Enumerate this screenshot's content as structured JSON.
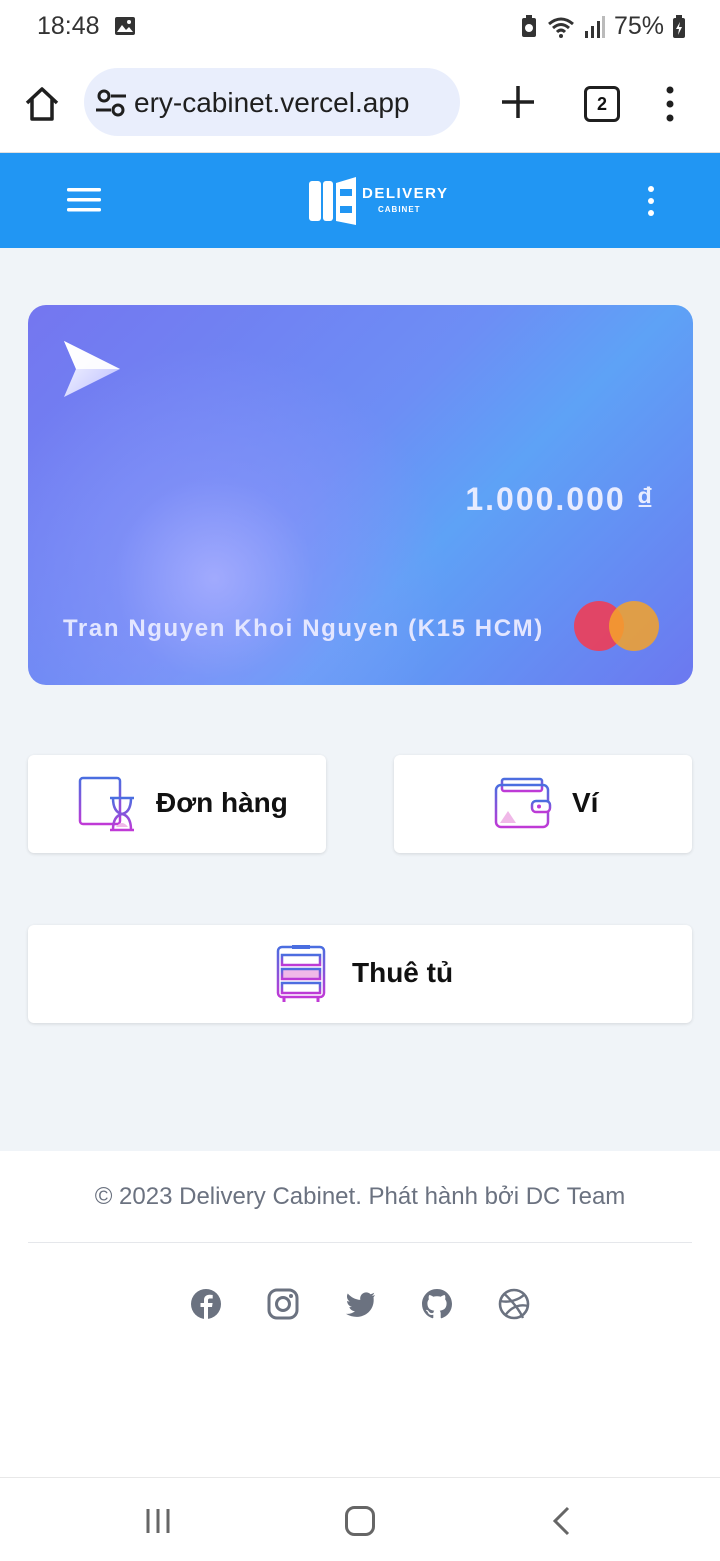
{
  "status_bar": {
    "time": "18:48",
    "battery": "75%"
  },
  "browser": {
    "url": "ery-cabinet.vercel.app",
    "tab_count": "2"
  },
  "app_header": {
    "logo_title": "DELIVERY",
    "logo_subtitle": "CABINET",
    "logo_mark": "DC",
    "bg_color": "#2196f3"
  },
  "card": {
    "balance": "1.000.000 ₫",
    "holder": "Tran Nguyen Khoi Nguyen (K15 HCM)"
  },
  "tiles": {
    "orders_label": "Đơn hàng",
    "wallet_label": "Ví",
    "rent_label": "Thuê tủ"
  },
  "footer": {
    "copyright": "© 2023 Delivery Cabinet. Phát hành bởi DC Team",
    "social_icons": [
      "facebook-icon",
      "instagram-icon",
      "twitter-icon",
      "github-icon",
      "dribbble-icon"
    ]
  }
}
